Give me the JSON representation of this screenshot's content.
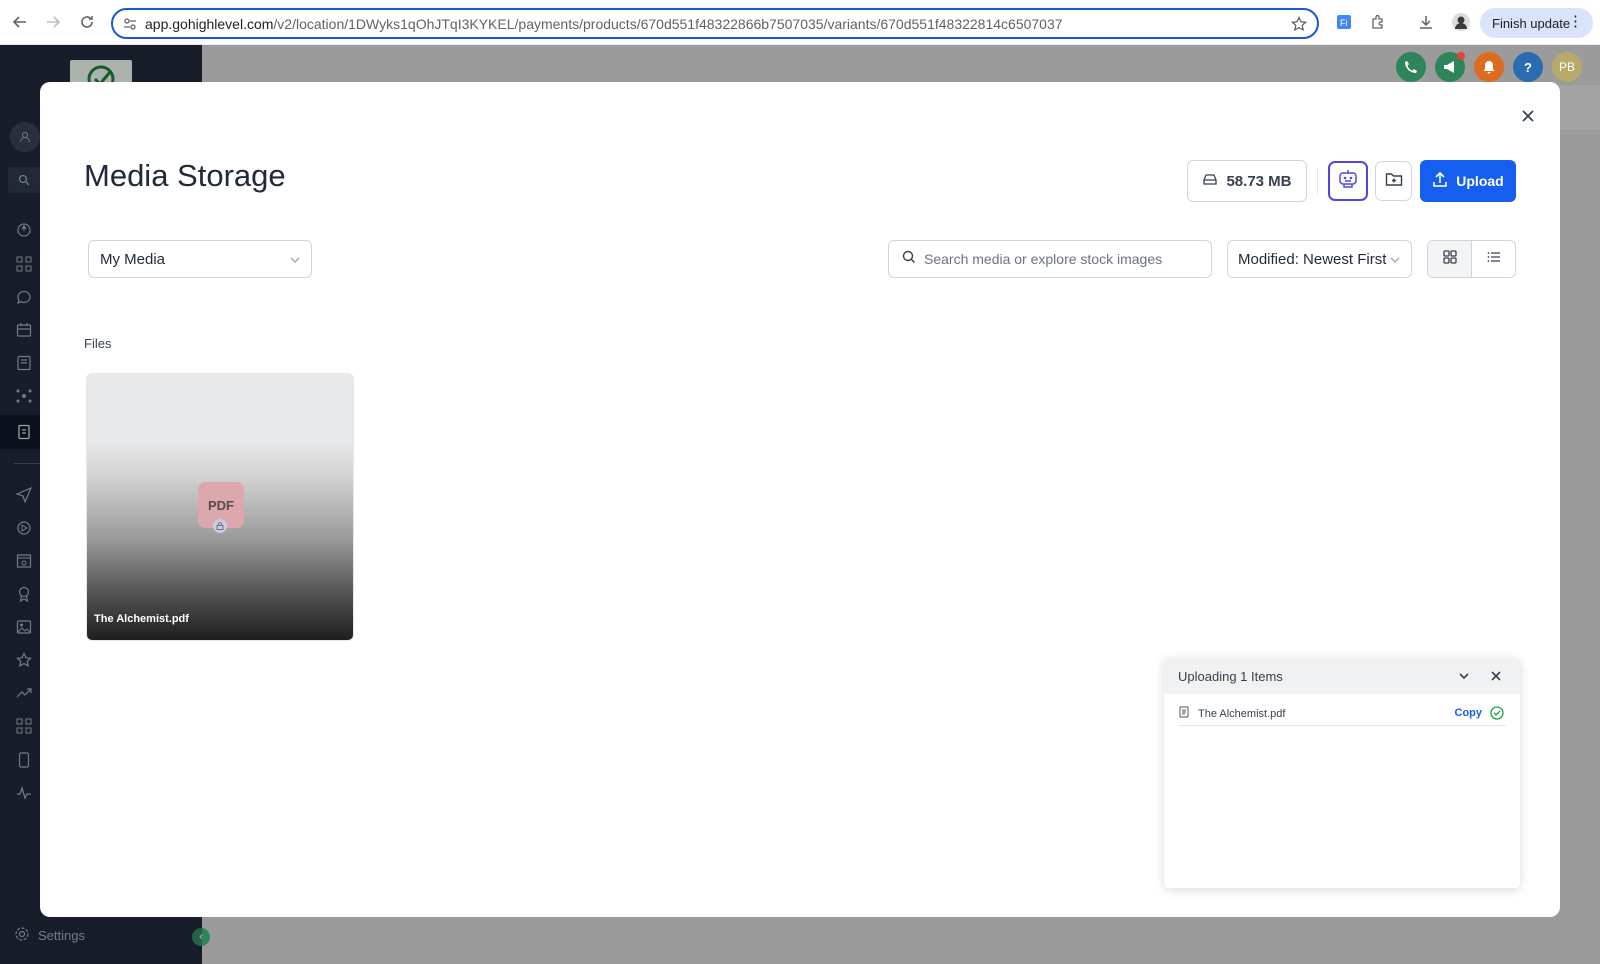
{
  "browser": {
    "url_domain": "app.gohighlevel.com",
    "url_path": "/v2/location/1DWyks1qOhJTqI3KYKEL/payments/products/670d551f48322866b7507035/variants/670d551f48322814c6507037",
    "finish_update_label": "Finish update",
    "menu_glyph": "⋮"
  },
  "sidebar": {
    "settings_label": "Settings",
    "icons": [
      "account-icon",
      "search-icon",
      "rocket-icon",
      "dashboard-icon",
      "chat-icon",
      "calendar-icon",
      "contacts-icon",
      "network-icon",
      "payments-icon",
      "send-icon",
      "marketing-icon",
      "sites-icon",
      "reputation-icon",
      "media-icon",
      "star-icon",
      "reporting-icon",
      "apps-icon",
      "mobile-icon",
      "activity-icon"
    ]
  },
  "topbar": {
    "avatar_initials": "PB",
    "help_glyph": "?"
  },
  "modal": {
    "title": "Media Storage",
    "storage_used": "58.73 MB",
    "upload_label": "Upload",
    "media_select_value": "My Media",
    "search_placeholder": "Search media or explore stock images",
    "sort_value": "Modified: Newest First",
    "view_mode": "grid",
    "files_heading": "Files",
    "files": [
      {
        "name": "The Alchemist.pdf",
        "type_badge": "PDF"
      }
    ]
  },
  "upload_panel": {
    "title": "Uploading 1 Items",
    "items": [
      {
        "name": "The Alchemist.pdf",
        "action_label": "Copy",
        "status": "complete"
      }
    ]
  },
  "colors": {
    "accent": "#155eef",
    "ai_border": "#4f46e5",
    "success": "#16a34a",
    "pdf_badge": "#dca7ad",
    "phone": "#2f855a",
    "megaphone": "#2f855a",
    "bell": "#dd6b20",
    "help": "#2b6cb0",
    "avatar": "#b7a96a"
  }
}
